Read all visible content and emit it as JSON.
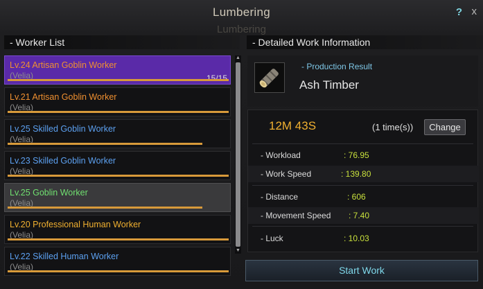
{
  "window": {
    "title": "Lumbering",
    "title_ghost": "Lumbering",
    "help": "?",
    "close": "x"
  },
  "worker_list": {
    "header": "- Worker List",
    "workers": [
      {
        "name": "Lv.24 Artisan Goblin Worker",
        "town": "Velia",
        "count": "15/15",
        "color": "#f09030",
        "selected": true,
        "stamina": 1.0
      },
      {
        "name": "Lv.21 Artisan Goblin Worker",
        "town": "Velia",
        "color": "#f09030",
        "stamina": 1.0
      },
      {
        "name": "Lv.25 Skilled Goblin Worker",
        "town": "Velia",
        "color": "#5ca0f0",
        "stamina": 0.88
      },
      {
        "name": "Lv.23 Skilled Goblin Worker",
        "town": "Velia",
        "color": "#5ca0f0",
        "stamina": 1.0
      },
      {
        "name": "Lv.25 Goblin Worker",
        "town": "Velia",
        "color": "#70e070",
        "highlight": true,
        "stamina": 0.88
      },
      {
        "name": "Lv.20 Professional Human Worker",
        "town": "Velia",
        "color": "#f0b030",
        "stamina": 1.0
      },
      {
        "name": "Lv.22 Skilled Human Worker",
        "town": "Velia",
        "color": "#5ca0f0",
        "stamina": 1.0
      }
    ]
  },
  "detail": {
    "header": "- Detailed Work Information",
    "production_label": "- Production Result",
    "product_name": "Ash Timber",
    "product_icon": "timber-icon",
    "time": "12M 43S",
    "times": "(1 time(s))",
    "change_label": "Change",
    "stats": [
      {
        "label": "- Workload",
        "value": ": 76.95"
      },
      {
        "label": "- Work Speed",
        "value": ": 139.80"
      },
      {
        "label": "- Distance",
        "value": ": 606"
      },
      {
        "label": "- Movement Speed",
        "value": ": 7.40"
      },
      {
        "label": "- Luck",
        "value": ": 10.03"
      }
    ],
    "start_label": "Start Work"
  }
}
